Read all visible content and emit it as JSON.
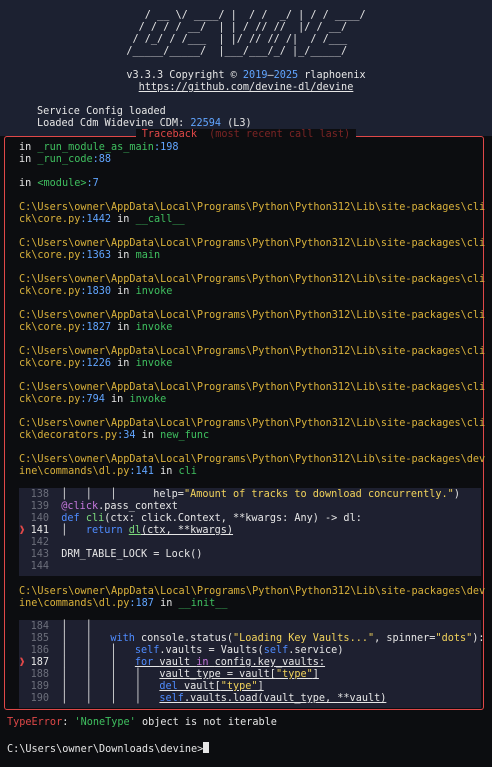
{
  "banner": {
    "ascii": [
      "   / __ \\/ ____/ |  / /  _/ | / / ____/",
      "  / / / / __/  | | / // //  |/ / __/   ",
      " / /_/ / /___  | |/ // // /|  / /___   ",
      "/_____/_____/  |___/___/_/ |_/_____/   "
    ],
    "version_prefix": "v3.3.3 Copyright © ",
    "years": "2019",
    "years_sep": "–",
    "years_end": "2025",
    "author": " rlaphoenix",
    "url": "https://github.com/devine-dl/devine"
  },
  "messages": {
    "service_config": "Service Config loaded",
    "cdm_prefix": "Loaded Cdm Widevine CDM: ",
    "cdm_id": "22594",
    "cdm_suffix": " (L3)"
  },
  "traceback": {
    "title": "Traceback",
    "subtitle": "(most recent call last)",
    "frames": [
      {
        "a": "in ",
        "b": "_run_module_as_main",
        "c": ":198"
      },
      {
        "a": "in ",
        "b": "_run_code",
        "c": ":88"
      },
      {
        "a": "in ",
        "b": "<module>",
        "c": ":7"
      }
    ],
    "site_paths": [
      {
        "p1": "C:\\Users\\owner\\AppData\\Local\\Programs\\Python\\Python312\\Lib\\site-packages\\cli",
        "p2": "ck\\core.py",
        "ln": ":1442",
        "in": " in ",
        "fn": "__call__"
      },
      {
        "p1": "C:\\Users\\owner\\AppData\\Local\\Programs\\Python\\Python312\\Lib\\site-packages\\cli",
        "p2": "ck\\core.py",
        "ln": ":1363",
        "in": " in ",
        "fn": "main"
      },
      {
        "p1": "C:\\Users\\owner\\AppData\\Local\\Programs\\Python\\Python312\\Lib\\site-packages\\cli",
        "p2": "ck\\core.py",
        "ln": ":1830",
        "in": " in ",
        "fn": "invoke"
      },
      {
        "p1": "C:\\Users\\owner\\AppData\\Local\\Programs\\Python\\Python312\\Lib\\site-packages\\cli",
        "p2": "ck\\core.py",
        "ln": ":1827",
        "in": " in ",
        "fn": "invoke"
      },
      {
        "p1": "C:\\Users\\owner\\AppData\\Local\\Programs\\Python\\Python312\\Lib\\site-packages\\cli",
        "p2": "ck\\core.py",
        "ln": ":1226",
        "in": " in ",
        "fn": "invoke"
      },
      {
        "p1": "C:\\Users\\owner\\AppData\\Local\\Programs\\Python\\Python312\\Lib\\site-packages\\cli",
        "p2": "ck\\core.py",
        "ln": ":794",
        "in": " in ",
        "fn": "invoke"
      },
      {
        "p1": "C:\\Users\\owner\\AppData\\Local\\Programs\\Python\\Python312\\Lib\\site-packages\\cli",
        "p2": "ck\\decorators.py",
        "ln": ":34",
        "in": " in ",
        "fn": "new_func"
      },
      {
        "p1": "C:\\Users\\owner\\AppData\\Local\\Programs\\Python\\Python312\\Lib\\site-packages\\dev",
        "p2": "ine\\commands\\dl.py",
        "ln": ":141",
        "in": " in ",
        "fn": "cli"
      },
      {
        "p1": "C:\\Users\\owner\\AppData\\Local\\Programs\\Python\\Python312\\Lib\\site-packages\\dev",
        "p2": "ine\\commands\\dl.py",
        "ln": ":187",
        "in": " in ",
        "fn": "__init__"
      }
    ],
    "code1": {
      "l138": {
        "n": "138",
        "t1": "  │   │   │      help=",
        "s": "\"Amount of tracks to download concurrently.\"",
        "t2": ")"
      },
      "l139": {
        "n": "139",
        "d": "@click",
        "t": ".pass_context"
      },
      "l140": {
        "n": "140",
        "k": "def ",
        "f": "cli",
        "t": "(ctx: click.Context, **kwargs: Any) -> dl:"
      },
      "l141": {
        "n": "141",
        "k": "return ",
        "f": "dl",
        "t": "(ctx, **kwargs)"
      },
      "l142": {
        "n": "142"
      },
      "l143": {
        "n": "143",
        "t": "DRM_TABLE_LOCK = Lock()"
      },
      "l144": {
        "n": "144"
      }
    },
    "code2": {
      "l184": {
        "n": "184"
      },
      "l185": {
        "n": "185",
        "k": "with ",
        "t1": "console.status(",
        "s": "\"Loading Key Vaults...\"",
        "t2": ", spinner=",
        "s2": "\"dots\"",
        "t3": "):"
      },
      "l186": {
        "n": "186",
        "k": "self",
        "t": ".vaults = Vaults(",
        "k2": "self",
        "t2": ".service)"
      },
      "l187": {
        "n": "187",
        "k": "for ",
        "t1": "vault ",
        "k2": "in ",
        "t2": "config.key_vaults:"
      },
      "l188": {
        "n": "188",
        "t1": "vault_type = vault[",
        "s": "\"type\"",
        "t2": "]"
      },
      "l189": {
        "n": "189",
        "k": "del ",
        "t1": "vault[",
        "s": "\"type\"",
        "t2": "]"
      },
      "l190": {
        "n": "190",
        "k": "self",
        "t": ".vaults.load(vault_type, **vault)"
      }
    }
  },
  "error": {
    "type": "TypeError",
    "colon": ": ",
    "quoted": "'NoneType'",
    "rest": " object is not iterable"
  },
  "prompt": "C:\\Users\\owner\\Downloads\\devine>"
}
